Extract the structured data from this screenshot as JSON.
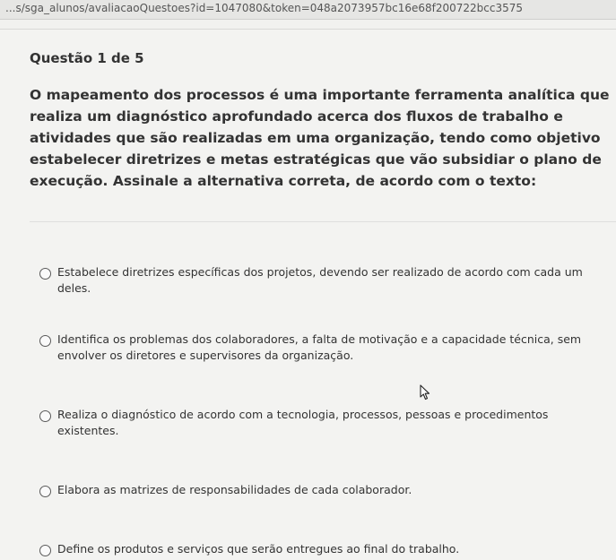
{
  "browser": {
    "url": "...s/sga_alunos/avaliacaoQuestoes?id=1047080&token=048a2073957bc16e68f200722bcc3575"
  },
  "question": {
    "number": "Questão 1 de 5",
    "text": "O mapeamento dos processos é uma importante ferramenta analítica que realiza um diagnóstico aprofundado acerca dos fluxos de trabalho e atividades que são realizadas em uma organização, tendo como objetivo estabelecer diretrizes e metas estratégicas que vão subsidiar o plano de execução. Assinale a alternativa correta, de acordo com o texto:"
  },
  "options": [
    {
      "label": "Estabelece diretrizes específicas dos projetos, devendo ser realizado de acordo com cada um deles."
    },
    {
      "label": "Identifica os problemas dos colaboradores, a falta de motivação e a capacidade técnica, sem envolver os diretores e supervisores da organização."
    },
    {
      "label": "Realiza o diagnóstico de acordo com a tecnologia, processos, pessoas e procedimentos existentes."
    },
    {
      "label": "Elabora as matrizes de responsabilidades de cada colaborador."
    },
    {
      "label": "Define os produtos e serviços que serão entregues ao final do trabalho."
    }
  ]
}
